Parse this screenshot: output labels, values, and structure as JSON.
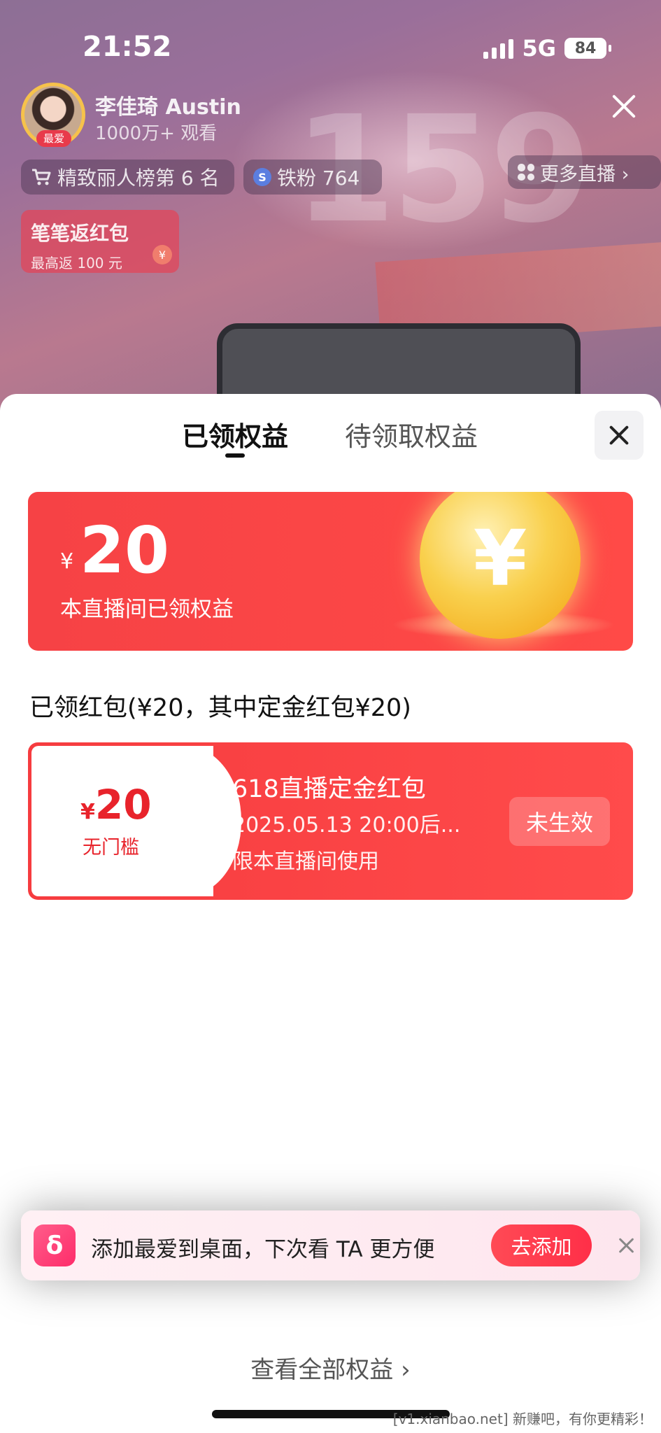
{
  "status_bar": {
    "time": "21:52",
    "network": "5G",
    "battery": "84"
  },
  "streamer": {
    "avatar_tag": "最爱",
    "name": "李佳琦 Austin",
    "viewers": "1000万+ 观看",
    "rank_chip": "精致丽人榜第 6 名",
    "fans_chip": "铁粉 764",
    "more_live": "更多直播 ›"
  },
  "stream_bg_text": "159",
  "redpack_promo": {
    "title": "笔笔返红包",
    "subtitle": "最高返 100 元",
    "icon": "¥"
  },
  "sheet": {
    "tabs": [
      "已领权益",
      "待领取权益"
    ],
    "summary": {
      "currency": "¥",
      "amount": "20",
      "description": "本直播间已领权益",
      "coin_symbol": "¥"
    },
    "section_title": "已领红包(¥20，其中定金红包¥20)",
    "coupon": {
      "currency": "¥",
      "value": "20",
      "threshold": "无门槛",
      "title": "618直播定金红包",
      "time": "2025.05.13 20:00后...",
      "scope": "限本直播间使用",
      "status": "未生效"
    },
    "banner": {
      "icon_glyph": "δ",
      "text": "添加最爱到桌面，下次看 TA 更方便",
      "button": "去添加"
    },
    "view_all": "查看全部权益 ›"
  },
  "watermark": "[v1.xianbao.net] 新赚吧，有你更精彩！",
  "colors": {
    "accent_red": "#f64245",
    "coupon_text_red": "#e8232b",
    "coin_gold": "#f9d04d"
  }
}
